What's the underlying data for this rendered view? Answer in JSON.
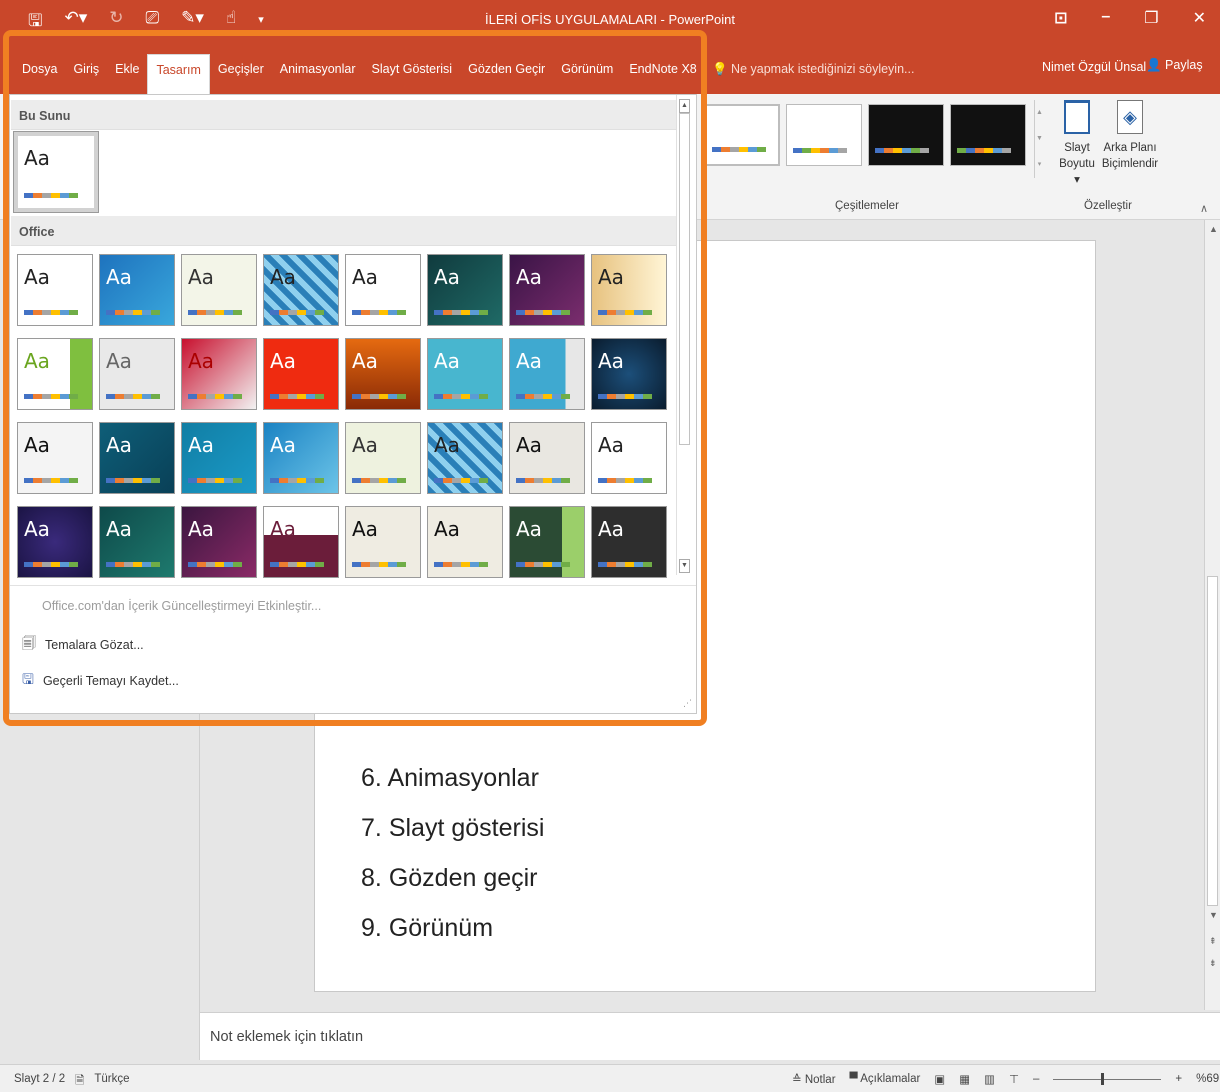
{
  "window": {
    "title": "İLERİ OFİS UYGULAMALARI - PowerPoint",
    "qa_icons": [
      "save-icon",
      "undo-icon",
      "redo-icon",
      "slideshow-icon",
      "pen-icon",
      "touch-icon",
      "customize-icon"
    ]
  },
  "tabs": [
    {
      "label": "Dosya",
      "active": false
    },
    {
      "label": "Giriş",
      "active": false
    },
    {
      "label": "Ekle",
      "active": false
    },
    {
      "label": "Tasarım",
      "active": true
    },
    {
      "label": "Geçişler",
      "active": false
    },
    {
      "label": "Animasyonlar",
      "active": false
    },
    {
      "label": "Slayt Gösterisi",
      "active": false
    },
    {
      "label": "Gözden Geçir",
      "active": false
    },
    {
      "label": "Görünüm",
      "active": false
    },
    {
      "label": "EndNote X8",
      "active": false
    }
  ],
  "tellme": "Ne yapmak istediğinizi söyleyin...",
  "user": "Nimet Özgül Ünsal",
  "share_label": "Paylaş",
  "ribbon": {
    "variants_label": "Çeşitlemeler",
    "customize_label": "Özelleştir",
    "slide_size_label_1": "Slayt",
    "slide_size_label_2": "Boyutu ▾",
    "bg_format_label_1": "Arka Planı",
    "bg_format_label_2": "Biçimlendir"
  },
  "gallery": {
    "section_current": "Bu Sunu",
    "section_office": "Office",
    "theme_glyph": "Aa",
    "enable_updates": "Office.com'dan İçerik Güncelleştirmeyi Etkinleştir...",
    "browse_themes": "Temalara Gözat...",
    "save_theme": "Geçerli Temayı Kaydet..."
  },
  "slide": {
    "items": [
      {
        "num": "6.",
        "text": "Animasyonlar"
      },
      {
        "num": "7.",
        "text": "Slayt gösterisi"
      },
      {
        "num": "8.",
        "text": "Gözden geçir"
      },
      {
        "num": "9.",
        "text": "Görünüm"
      }
    ]
  },
  "notes_placeholder": "Not eklemek için tıklatın",
  "status": {
    "slide_counter": "Slayt 2 / 2",
    "language": "Türkçe",
    "notes_label": "Notlar",
    "comments_label": "Açıklamalar",
    "zoom": "%69"
  },
  "colors": {
    "accent": "#c9472a",
    "highlight": "#f07f22"
  }
}
